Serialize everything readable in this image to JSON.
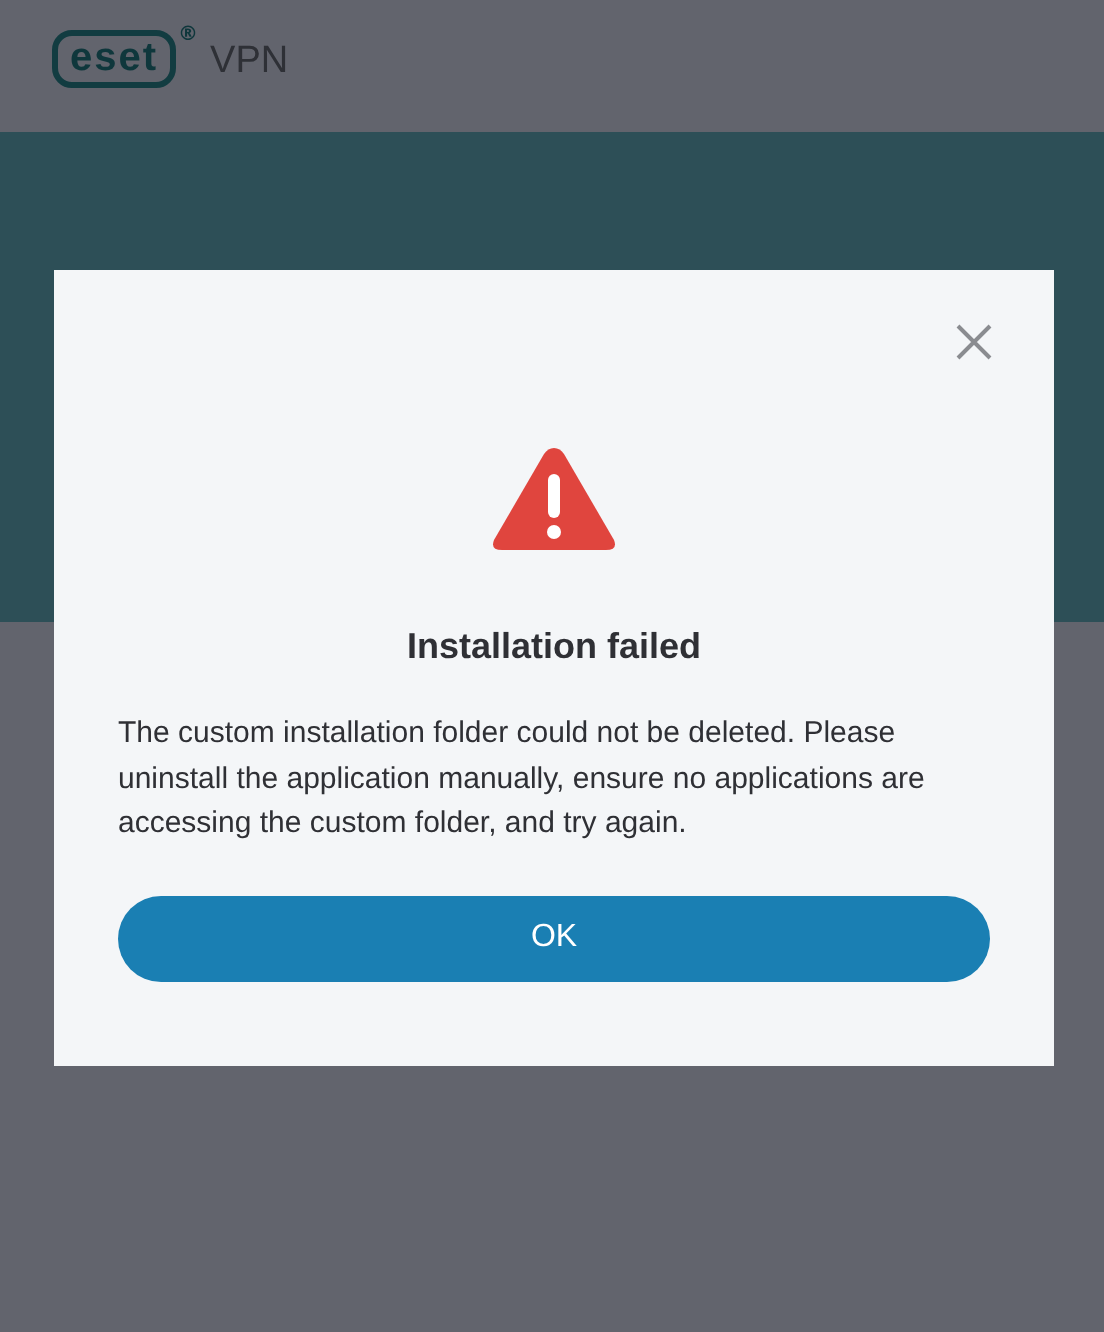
{
  "header": {
    "logo": "eset",
    "registered": "®",
    "product": "VPN"
  },
  "dialog": {
    "title": "Installation failed",
    "message": "The custom installation folder could not be deleted. Please uninstall the application manually, ensure no applications are accessing the custom folder, and try again.",
    "buttons": [
      "OK"
    ]
  }
}
